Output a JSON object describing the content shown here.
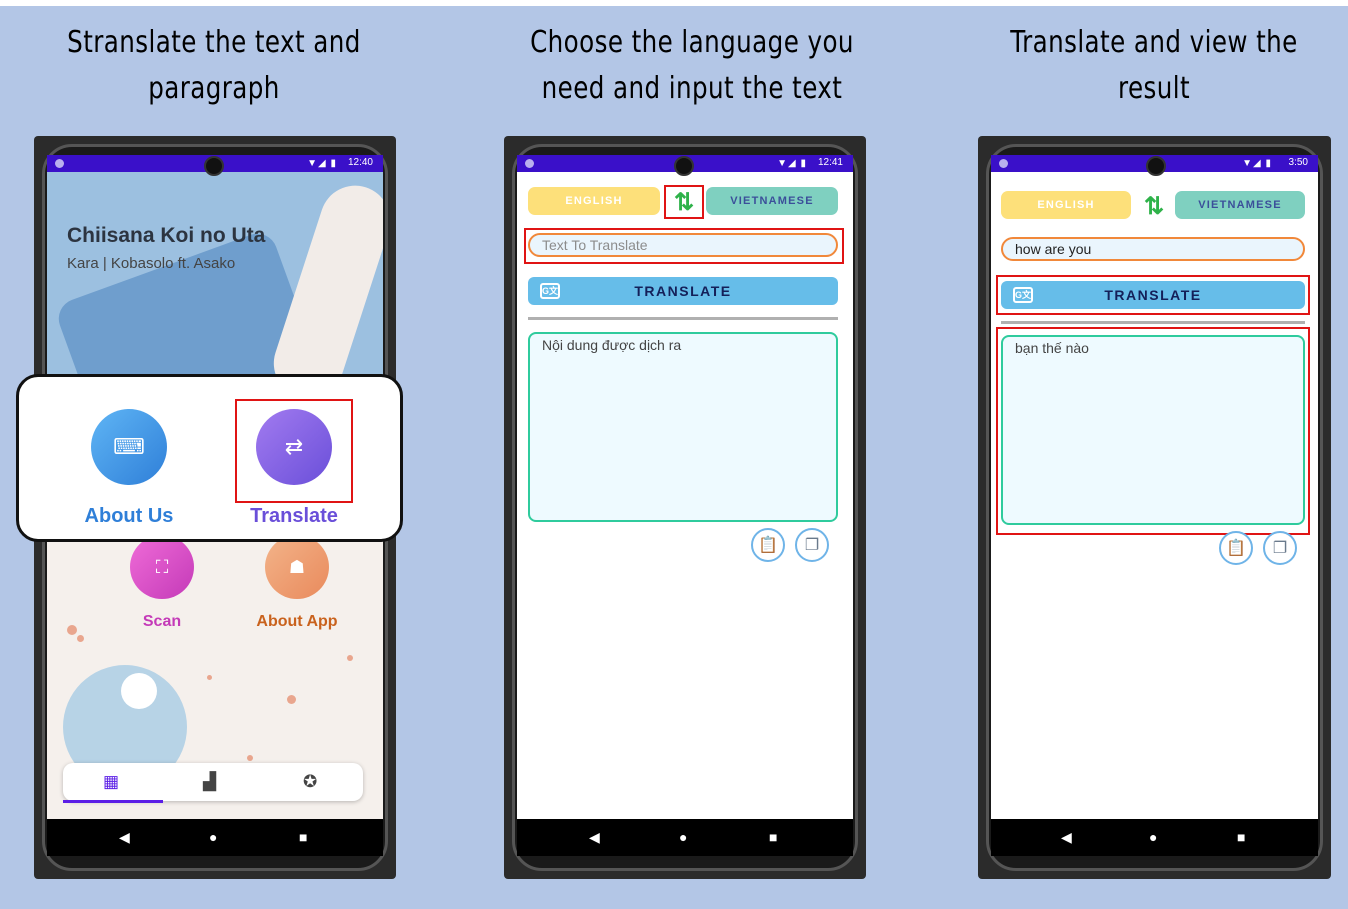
{
  "titles": {
    "step1": "Stranslate the text and paragraph",
    "step2": "Choose the language you need and input the text",
    "step3": "Translate and view the result"
  },
  "colors": {
    "background": "#b3c6e6",
    "status_bar": "#3a10c9",
    "highlight": "#e01414"
  },
  "phone1": {
    "status_time": "12:40",
    "song_title": "Chiisana Koi no Uta",
    "song_subtitle": "Kara | Kobasolo ft. Asako",
    "menu": [
      {
        "label": "About Us",
        "icon": "laptop-code-icon",
        "color": "#2f7fd8"
      },
      {
        "label": "Translate",
        "icon": "translate-icon",
        "color": "#6a4fd9"
      },
      {
        "label": "Scan",
        "icon": "scan-icon",
        "color": "#c43ab8"
      },
      {
        "label": "About App",
        "icon": "android-icon",
        "color": "#c9621d"
      }
    ],
    "bottom_nav": [
      "calendar-icon",
      "chart-icon",
      "award-icon"
    ]
  },
  "phone2": {
    "status_time": "12:41",
    "source_lang": "ENGLISH",
    "target_lang": "VIETNAMESE",
    "input_placeholder": "Text To Translate",
    "translate_label": "TRANSLATE",
    "result_text": "Nội dung được dịch ra"
  },
  "phone3": {
    "status_time": "3:50",
    "source_lang": "ENGLISH",
    "target_lang": "VIETNAMESE",
    "input_value": "how are you",
    "translate_label": "TRANSLATE",
    "result_text": "bạn thế nào"
  },
  "navbar": {
    "back": "◀",
    "home": "●",
    "recents": "■"
  }
}
